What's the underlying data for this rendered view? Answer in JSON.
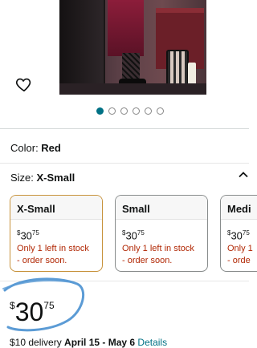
{
  "gallery": {
    "dot_count": 6,
    "active_index": 0
  },
  "variation": {
    "color_label": "Color: ",
    "color_value": "Red",
    "size_label": "Size: ",
    "size_value": "X-Small"
  },
  "size_options": [
    {
      "name": "X-Small",
      "currency": "$",
      "whole": "30",
      "cents": "75",
      "stock": "Only 1 left in stock",
      "stock2": "- order soon.",
      "selected": true
    },
    {
      "name": "Small",
      "currency": "$",
      "whole": "30",
      "cents": "75",
      "stock": "Only 1 left in stock",
      "stock2": "- order soon.",
      "selected": false
    },
    {
      "name": "Medi",
      "currency": "$",
      "whole": "30",
      "cents": "75",
      "stock": "Only 1",
      "stock2": "- orde",
      "selected": false
    }
  ],
  "price": {
    "currency": "$",
    "whole": "30",
    "cents": "75"
  },
  "delivery": {
    "prefix": "$10 delivery ",
    "dates": "April 15 - May 6",
    "link": "Details"
  },
  "colors": {
    "accent": "#007185",
    "stock_red": "#b12704",
    "selected_border": "#c7923b",
    "scribble": "#5b9bd5"
  }
}
